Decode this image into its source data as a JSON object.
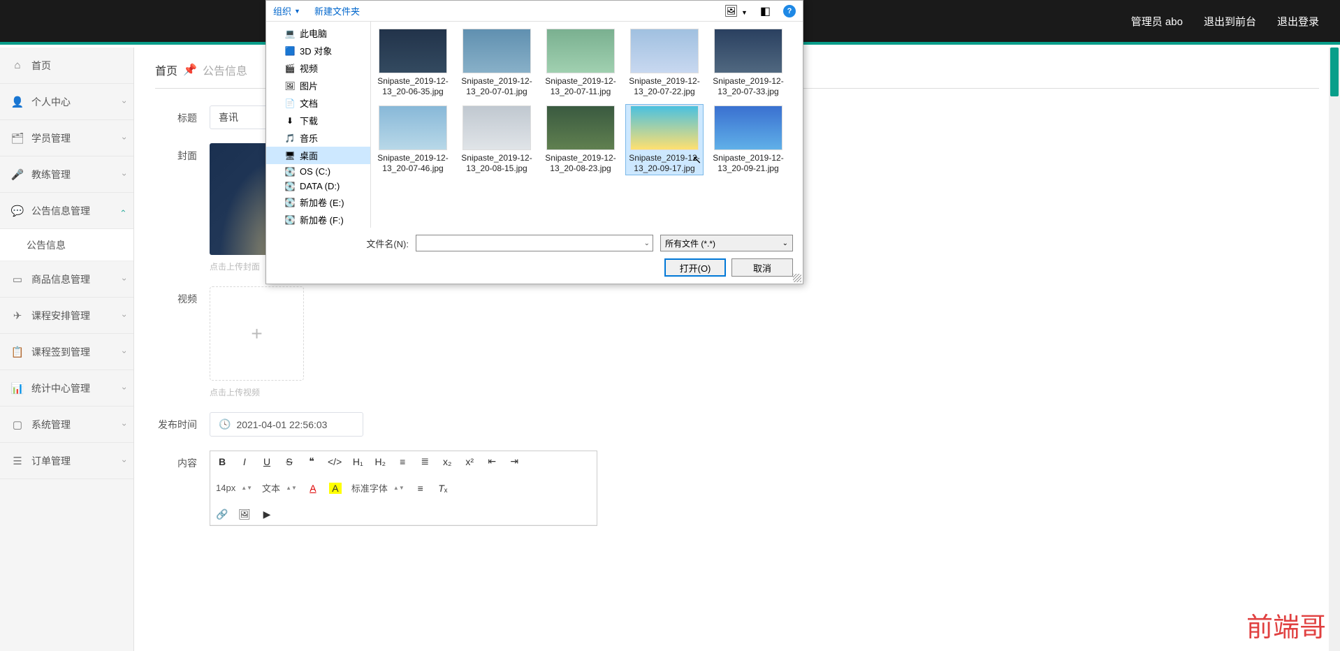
{
  "header": {
    "admin": "管理员 abo",
    "front": "退出到前台",
    "logout": "退出登录"
  },
  "sidebar": {
    "items": [
      {
        "icon": "⌂",
        "label": "首页",
        "expand": null
      },
      {
        "icon": "👤",
        "label": "个人中心",
        "expand": "down"
      },
      {
        "icon": "🗂",
        "label": "学员管理",
        "expand": "down"
      },
      {
        "icon": "🎤",
        "label": "教练管理",
        "expand": "down"
      },
      {
        "icon": "💬",
        "label": "公告信息管理",
        "expand": "up"
      },
      {
        "icon": "",
        "label": "公告信息",
        "sub": true
      },
      {
        "icon": "▭",
        "label": "商品信息管理",
        "expand": "down"
      },
      {
        "icon": "✈",
        "label": "课程安排管理",
        "expand": "down"
      },
      {
        "icon": "📋",
        "label": "课程签到管理",
        "expand": "down"
      },
      {
        "icon": "📊",
        "label": "统计中心管理",
        "expand": "down"
      },
      {
        "icon": "▢",
        "label": "系统管理",
        "expand": "down"
      },
      {
        "icon": "☰",
        "label": "订单管理",
        "expand": "down"
      }
    ]
  },
  "crumb": {
    "home": "首页",
    "pin": "📌",
    "section": "公告信息"
  },
  "form": {
    "title_label": "标题",
    "title_value": "喜讯",
    "cover_label": "封面",
    "cover_hint": "点击上传封面",
    "video_label": "视频",
    "video_hint": "点击上传视频",
    "publish_label": "发布时间",
    "publish_value": "2021-04-01 22:56:03",
    "content_label": "内容",
    "editor": {
      "fontsize": "14px",
      "font_style": "文本",
      "font_family": "标准字体"
    }
  },
  "dialog": {
    "organize": "组织",
    "newfolder": "新建文件夹",
    "tree": [
      {
        "icon": "💻",
        "label": "此电脑"
      },
      {
        "icon": "🟦",
        "label": "3D 对象"
      },
      {
        "icon": "🎬",
        "label": "视频"
      },
      {
        "icon": "🖼",
        "label": "图片"
      },
      {
        "icon": "📄",
        "label": "文档"
      },
      {
        "icon": "⬇",
        "label": "下载"
      },
      {
        "icon": "🎵",
        "label": "音乐"
      },
      {
        "icon": "🖥",
        "label": "桌面",
        "selected": true
      },
      {
        "icon": "💽",
        "label": "OS (C:)"
      },
      {
        "icon": "💽",
        "label": "DATA (D:)"
      },
      {
        "icon": "💽",
        "label": "新加卷 (E:)"
      },
      {
        "icon": "💽",
        "label": "新加卷 (F:)"
      }
    ],
    "files": [
      {
        "name": "Snipaste_2019-12-13_20-06-35.jpg",
        "cls": "th1"
      },
      {
        "name": "Snipaste_2019-12-13_20-07-01.jpg",
        "cls": "th2"
      },
      {
        "name": "Snipaste_2019-12-13_20-07-11.jpg",
        "cls": "th3"
      },
      {
        "name": "Snipaste_2019-12-13_20-07-22.jpg",
        "cls": "th4"
      },
      {
        "name": "Snipaste_2019-12-13_20-07-33.jpg",
        "cls": "th5"
      },
      {
        "name": "Snipaste_2019-12-13_20-07-46.jpg",
        "cls": "th6"
      },
      {
        "name": "Snipaste_2019-12-13_20-08-15.jpg",
        "cls": "th7"
      },
      {
        "name": "Snipaste_2019-12-13_20-08-23.jpg",
        "cls": "th8"
      },
      {
        "name": "Snipaste_2019-12-13_20-09-17.jpg",
        "cls": "th9",
        "selected": true
      },
      {
        "name": "Snipaste_2019-12-13_20-09-21.jpg",
        "cls": "th10"
      }
    ],
    "filename_label": "文件名(N):",
    "filter": "所有文件 (*.*)",
    "open": "打开(O)",
    "cancel": "取消"
  },
  "watermark": "前端哥"
}
